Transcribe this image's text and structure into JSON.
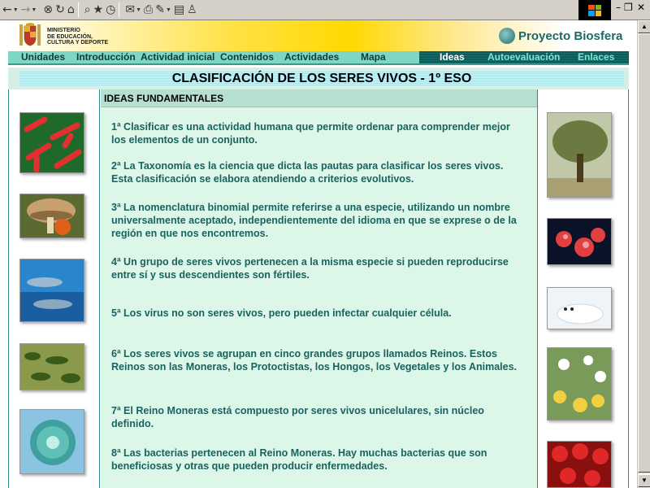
{
  "toolbar": {
    "back_icon": "←",
    "forward_icon": "→",
    "stop_icon": "⊗",
    "refresh_icon": "↻",
    "home_icon": "⌂",
    "search_icon": "⌕",
    "favorites_icon": "★",
    "history_icon": "◷",
    "mail_icon": "✉",
    "print_icon": "⎙",
    "edit_icon": "✎",
    "discuss_icon": "▤",
    "messenger_icon": "♙",
    "minimize": "–",
    "restore": "❐",
    "close": "✕"
  },
  "header": {
    "ministerio_lines": [
      "MINISTERIO",
      "DE EDUCACIÓN,",
      "CULTURA Y DEPORTE"
    ],
    "brand": "Proyecto Biosfera"
  },
  "nav": {
    "items": [
      {
        "label": "Unidades"
      },
      {
        "label": "Introducción"
      },
      {
        "label": "Actividad inicial"
      },
      {
        "label": "Contenidos"
      },
      {
        "label": "Actividades"
      },
      {
        "label": "Mapa"
      },
      {
        "label": "Ideas"
      },
      {
        "label": "Autoevaluación"
      },
      {
        "label": "Enlaces"
      }
    ]
  },
  "page": {
    "title": "CLASIFICACIÓN DE LOS SERES VIVOS - 1º ESO",
    "section_heading": "IDEAS FUNDAMENTALES"
  },
  "ideas": [
    {
      "text": "1ª Clasificar es una actividad humana que permite ordenar para comprender mejor los elementos de un conjunto."
    },
    {
      "text": "2ª La Taxonomía es la ciencia que dicta las pautas para clasificar los seres vivos. Esta clasificación se elabora atendiendo a criterios evolutivos."
    },
    {
      "text": "3ª La nomenclatura binomial permite referirse a una especie, utilizando un nombre universalmente aceptado, independientemente del idioma en que se exprese o de la región en que nos encontremos."
    },
    {
      "text": "4ª Un grupo de seres vivos pertenecen a la misma especie si pueden reproducirse entre sí y sus descendientes son fértiles."
    },
    {
      "text": "5ª Los virus no son seres vivos, pero pueden infectar cualquier célula."
    },
    {
      "text": "6ª Los seres vivos se agrupan en cinco grandes grupos llamados Reinos. Estos Reinos son las Moneras, los Protoctistas, los Hongos, los Vegetales y los Animales."
    },
    {
      "text": "7ª El Reino Moneras está compuesto por seres vivos unicelulares, sin núcleo definido."
    },
    {
      "text": "8ª Las bacterias pertenecen al Reino Moneras. Hay muchas bacterias que son beneficiosas y otras que pueden producir enfermedades."
    }
  ],
  "colors": {
    "accent_teal": "#1a6260",
    "nav_bg": "#7ed6c4",
    "content_bg": "#dcf7e8"
  }
}
